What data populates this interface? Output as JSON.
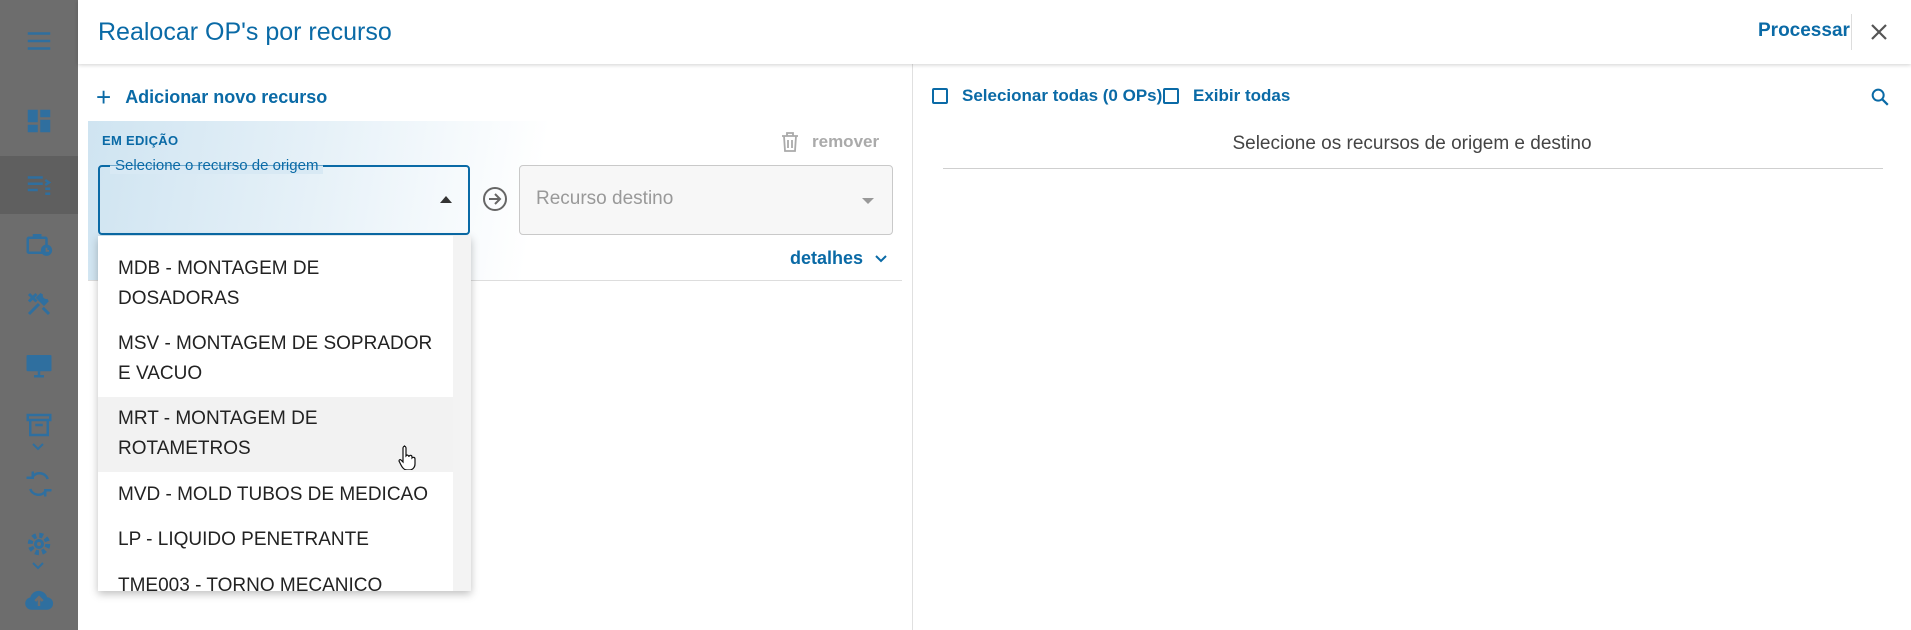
{
  "sidebar": {
    "items": [
      {
        "icon": "menu-icon"
      },
      {
        "icon": "dashboard-icon"
      },
      {
        "icon": "list-icon"
      },
      {
        "icon": "briefcase-clock-icon"
      },
      {
        "icon": "tools-icon"
      },
      {
        "icon": "monitor-icon"
      },
      {
        "icon": "archive-icon"
      },
      {
        "icon": "sync-icon"
      },
      {
        "icon": "gear-icon"
      },
      {
        "icon": "cloud-upload-icon"
      }
    ]
  },
  "header": {
    "title": "Realocar OP's por recurso",
    "process_label": "Processar"
  },
  "left_panel": {
    "add_resource_label": "Adicionar novo recurso",
    "card": {
      "status_label": "EM EDIÇÃO",
      "remove_label": "remover",
      "origin_label": "Selecione o recurso de origem",
      "destination_placeholder": "Recurso destino",
      "details_label": "detalhes"
    },
    "dropdown_options": [
      "MDB - MONTAGEM DE DOSADORAS",
      "MSV - MONTAGEM DE SOPRADOR E VACUO",
      "MRT - MONTAGEM DE ROTAMETROS",
      "MVD - MOLD TUBOS DE MEDICAO",
      "LP - LIQUIDO PENETRANTE",
      "TME003 - TORNO MECANICO"
    ]
  },
  "right_panel": {
    "select_all_label": "Selecionar todas (0 OPs)",
    "show_all_label": "Exibir todas",
    "empty_message": "Selecione os recursos de origem e destino"
  },
  "colors": {
    "accent": "#0a6aa6",
    "sidebar_bg": "#6d6d6d"
  }
}
